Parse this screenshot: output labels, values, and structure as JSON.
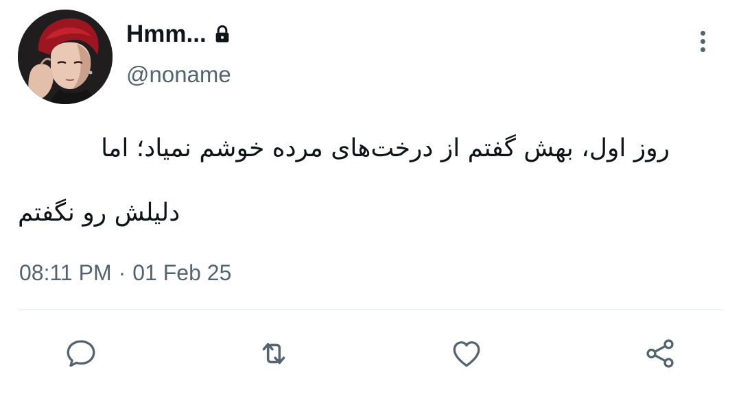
{
  "author": {
    "display_name": "Hmm...",
    "handle": "@noname",
    "protected_icon": "lock-icon",
    "avatar_icon": "profile-photo"
  },
  "tweet": {
    "text_line_1": "روز اول، بهش گفتم از درخت‌های مرده خوشم نمیاد؛ اما",
    "text_line_2": "دلیلش رو نگفتم",
    "time": "08:11 PM",
    "separator": "·",
    "date": "01 Feb 25"
  },
  "actions": [
    {
      "name": "reply",
      "icon": "comment-icon"
    },
    {
      "name": "retweet",
      "icon": "retweet-icon"
    },
    {
      "name": "like",
      "icon": "heart-icon"
    },
    {
      "name": "share",
      "icon": "share-icon"
    }
  ],
  "colors": {
    "text_primary": "#0f1419",
    "text_secondary": "#536471",
    "divider": "#eff3f4"
  }
}
